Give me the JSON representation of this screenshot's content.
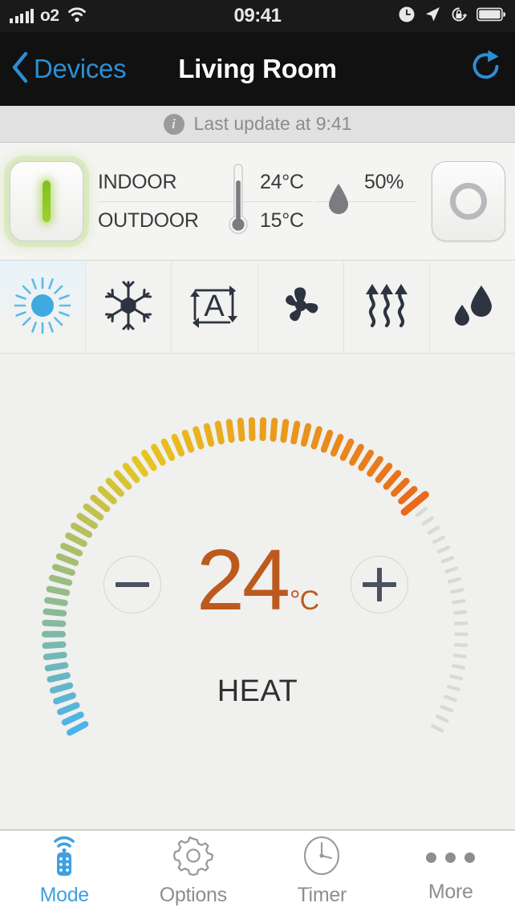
{
  "status_bar": {
    "carrier": "o2",
    "time": "09:41",
    "icons": [
      "signal-bars-icon",
      "wifi-icon",
      "alarm-clock-icon",
      "location-arrow-icon",
      "rotation-lock-icon",
      "battery-icon"
    ]
  },
  "nav": {
    "back_label": "Devices",
    "title": "Living Room",
    "refresh_icon": "refresh-icon",
    "back_icon": "chevron-left-icon",
    "accent_color": "#2b8fd4"
  },
  "update_bar": {
    "info_icon": "i",
    "text": "Last update at 9:41"
  },
  "info_panel": {
    "power_on_icon": "power-on-icon",
    "power_off_icon": "power-off-icon",
    "indoor_label": "INDOOR",
    "outdoor_label": "OUTDOOR",
    "indoor_temp": "24°C",
    "outdoor_temp": "15°C",
    "humidity": "50%",
    "thermometer_icon": "thermometer-icon",
    "humidity_icon": "water-drop-icon",
    "on_color": "#8fc72b"
  },
  "modes": [
    {
      "name": "heat",
      "icon": "sun-icon",
      "active": true
    },
    {
      "name": "cool",
      "icon": "snowflake-icon",
      "active": false
    },
    {
      "name": "auto",
      "icon": "auto-cycle-icon",
      "active": false
    },
    {
      "name": "fan",
      "icon": "fan-icon",
      "active": false
    },
    {
      "name": "heat-waves",
      "icon": "heat-waves-icon",
      "active": false
    },
    {
      "name": "dry",
      "icon": "water-drops-icon",
      "active": false
    }
  ],
  "dial": {
    "value": "24",
    "unit": "°C",
    "mode_label": "HEAT",
    "decrease_label": "−",
    "increase_label": "+",
    "value_color": "#bc5a1e",
    "arc_start_color": "#4bb3e8",
    "arc_mid_color": "#e8c520",
    "arc_end_color": "#e8691c",
    "inactive_color": "#d9d9d7",
    "filled_percent": 72
  },
  "tabs": [
    {
      "label": "Mode",
      "icon": "remote-control-icon",
      "active": true
    },
    {
      "label": "Options",
      "icon": "gear-icon",
      "active": false
    },
    {
      "label": "Timer",
      "icon": "clock-icon",
      "active": false
    },
    {
      "label": "More",
      "icon": "ellipsis-icon",
      "active": false
    }
  ]
}
